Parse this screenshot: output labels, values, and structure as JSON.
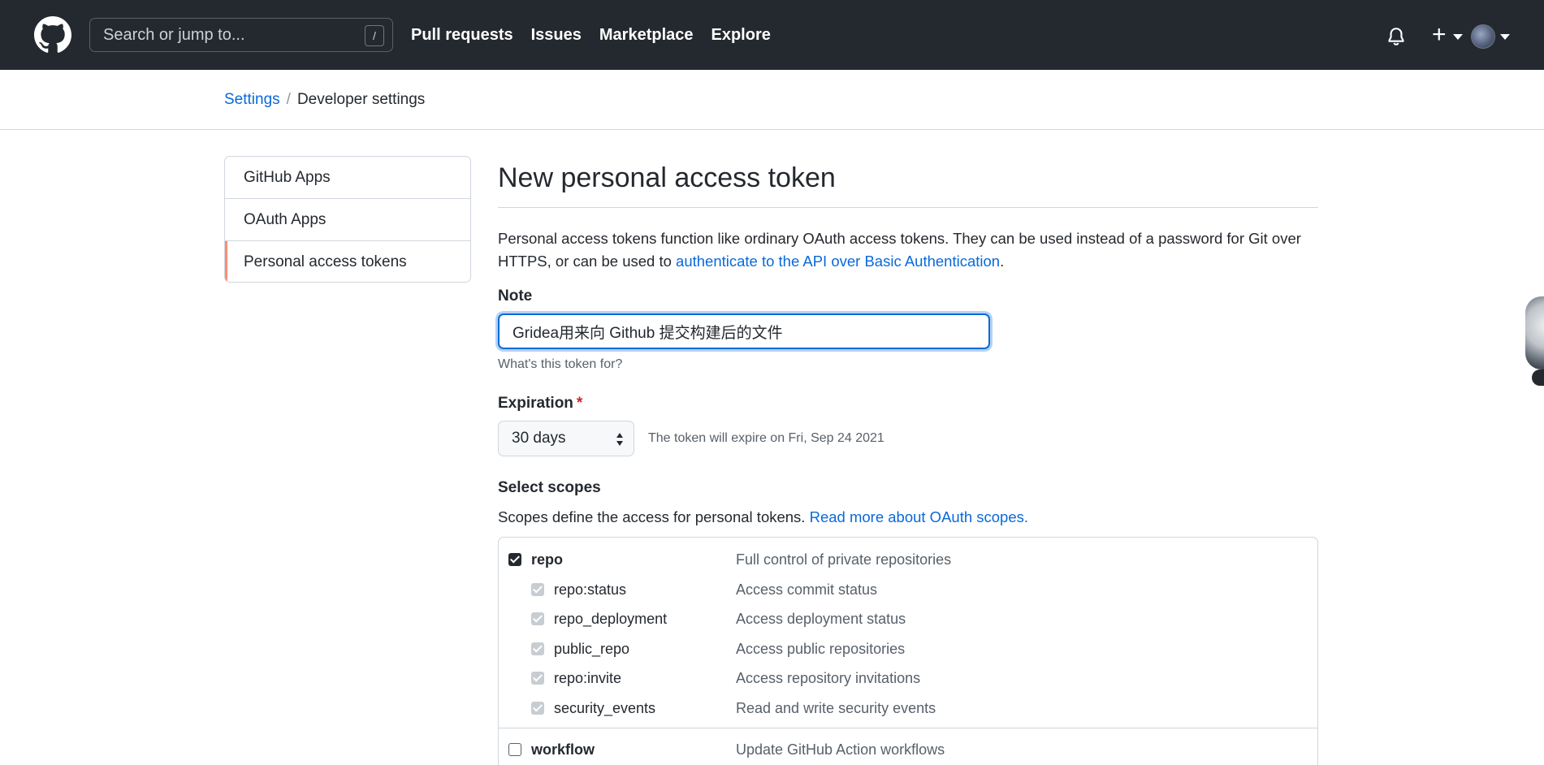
{
  "header": {
    "search_placeholder": "Search or jump to...",
    "search_shortcut": "/",
    "nav": [
      "Pull requests",
      "Issues",
      "Marketplace",
      "Explore"
    ],
    "plus_symbol": "+"
  },
  "breadcrumb": {
    "parent": "Settings",
    "separator": "/",
    "current": "Developer settings"
  },
  "sidebar": {
    "items": [
      "GitHub Apps",
      "OAuth Apps",
      "Personal access tokens"
    ],
    "active_index": 2
  },
  "main": {
    "title": "New personal access token",
    "description_prefix": "Personal access tokens function like ordinary OAuth access tokens. They can be used instead of a password for Git over HTTPS, or can be used to ",
    "description_link": "authenticate to the API over Basic Authentication",
    "description_suffix": ".",
    "note_label": "Note",
    "note_value": "Gridea用来向 Github 提交构建后的文件",
    "note_hint": "What's this token for?",
    "expiration_label": "Expiration",
    "expiration_required": "*",
    "expiration_value": "30 days",
    "expiration_text": "The token will expire on Fri, Sep 24 2021",
    "scopes_label": "Select scopes",
    "scopes_desc_prefix": "Scopes define the access for personal tokens. ",
    "scopes_desc_link": "Read more about OAuth scopes."
  },
  "scopes": [
    {
      "name": "repo",
      "desc": "Full control of private repositories",
      "checked": true,
      "child": false
    },
    {
      "name": "repo:status",
      "desc": "Access commit status",
      "checked": true,
      "child": true
    },
    {
      "name": "repo_deployment",
      "desc": "Access deployment status",
      "checked": true,
      "child": true
    },
    {
      "name": "public_repo",
      "desc": "Access public repositories",
      "checked": true,
      "child": true
    },
    {
      "name": "repo:invite",
      "desc": "Access repository invitations",
      "checked": true,
      "child": true
    },
    {
      "name": "security_events",
      "desc": "Read and write security events",
      "checked": true,
      "child": true
    },
    {
      "name": "workflow",
      "desc": "Update GitHub Action workflows",
      "checked": false,
      "child": false
    }
  ],
  "colors": {
    "header_bg": "#24292f",
    "link": "#0969da",
    "active_accent": "#fd8c73",
    "required": "#cf222e"
  },
  "icons": [
    "github-logo-icon",
    "bell-icon",
    "plus-icon",
    "chevron-down-icon",
    "select-arrows-icon",
    "checkbox-icon"
  ]
}
